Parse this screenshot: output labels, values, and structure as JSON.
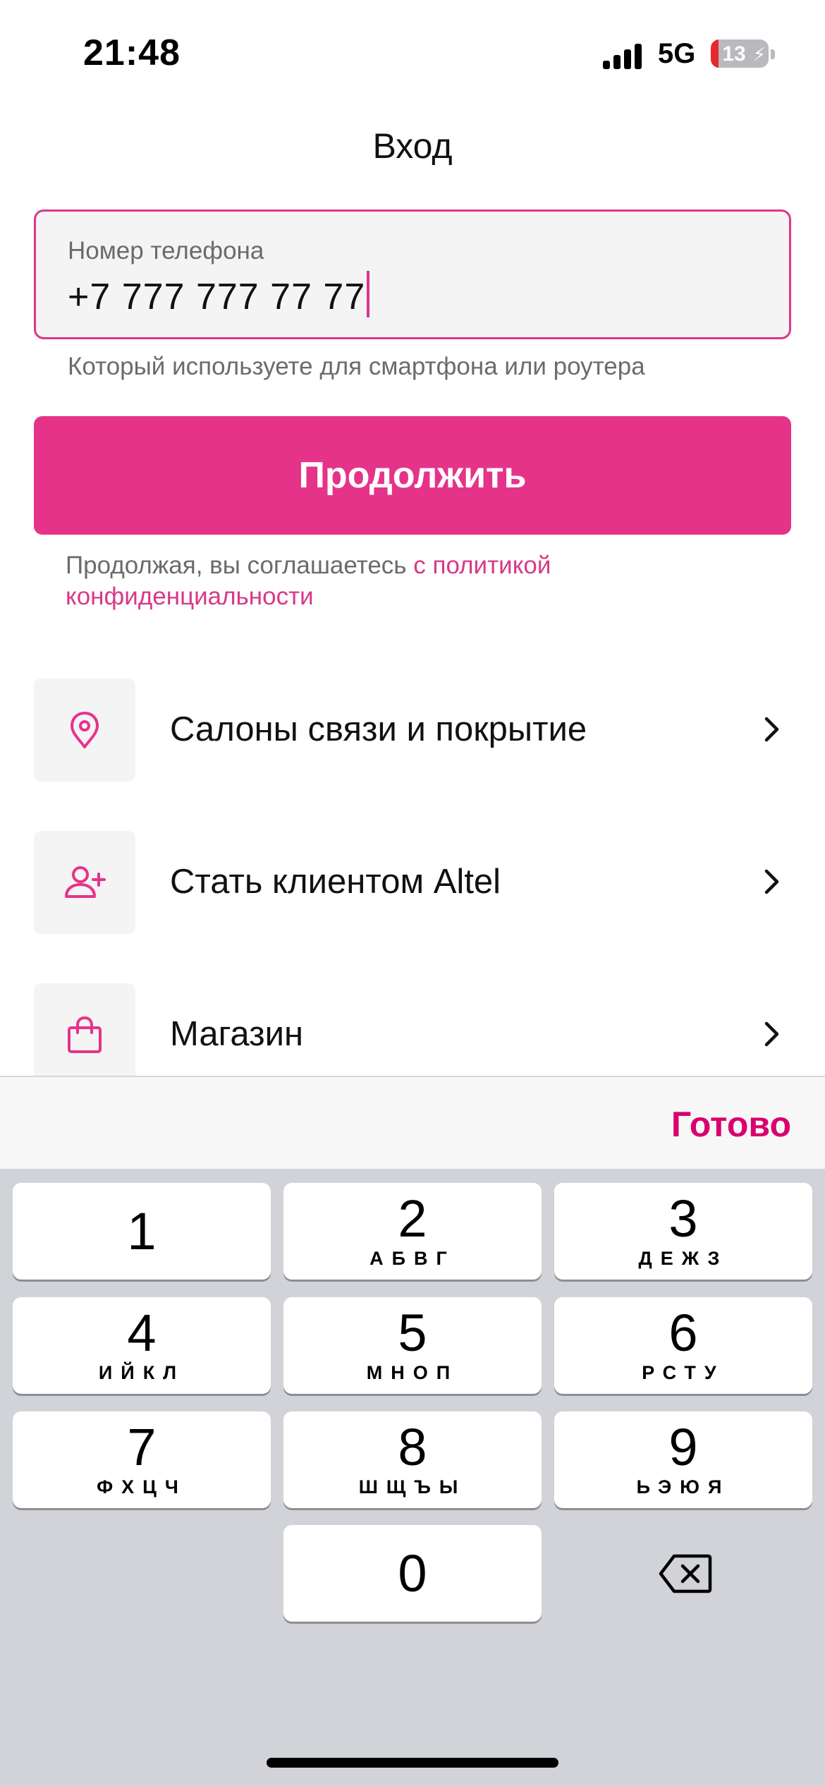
{
  "status_bar": {
    "time": "21:48",
    "network": "5G",
    "battery_percent": "13",
    "battery_level": 0.13,
    "battery_charging": true
  },
  "header": {
    "title": "Вход"
  },
  "phone_field": {
    "label": "Номер телефона",
    "value": "+7 777 777 77 77",
    "hint": "Который используете для смартфона или роутера"
  },
  "continue_button": {
    "label": "Продолжить"
  },
  "consent": {
    "text": "Продолжая, вы соглашаетесь ",
    "link": "с политикой конфиденциальности"
  },
  "menu": {
    "items": [
      {
        "label": "Салоны связи и покрытие",
        "icon": "location-pin-icon"
      },
      {
        "label": "Стать клиентом Altel",
        "icon": "add-user-icon"
      },
      {
        "label": "Магазин",
        "icon": "shopping-bag-icon"
      }
    ]
  },
  "keyboard": {
    "done_label": "Готово",
    "keys": [
      {
        "digit": "1",
        "letters": ""
      },
      {
        "digit": "2",
        "letters": "АБВГ"
      },
      {
        "digit": "3",
        "letters": "ДЕЖЗ"
      },
      {
        "digit": "4",
        "letters": "ИЙКЛ"
      },
      {
        "digit": "5",
        "letters": "МНОП"
      },
      {
        "digit": "6",
        "letters": "РСТУ"
      },
      {
        "digit": "7",
        "letters": "ФХЦЧ"
      },
      {
        "digit": "8",
        "letters": "ШЩЪЫ"
      },
      {
        "digit": "9",
        "letters": "ЬЭЮЯ"
      },
      {
        "digit": "0",
        "letters": ""
      }
    ]
  },
  "colors": {
    "accent": "#e6338a",
    "accent_text": "#d9006f",
    "battery_low": "#e5292f"
  }
}
